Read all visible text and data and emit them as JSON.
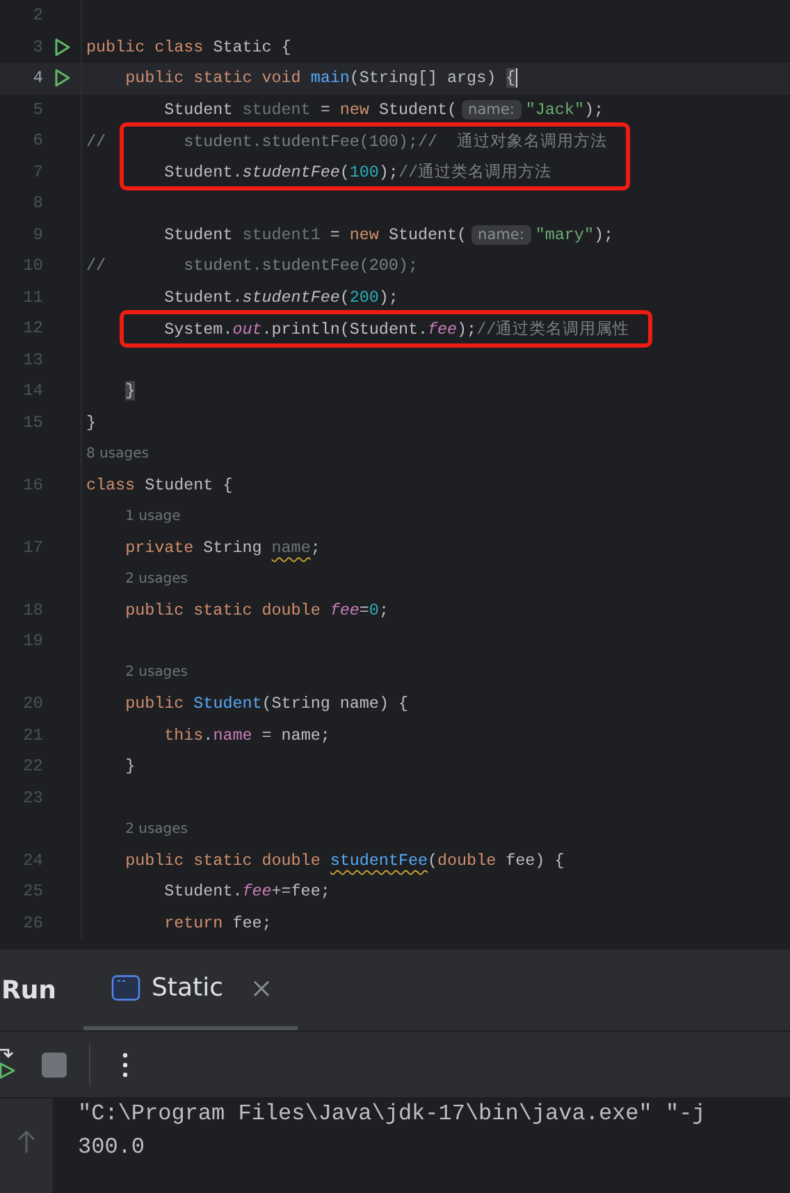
{
  "editor": {
    "lines": [
      {
        "kind": "code",
        "number": "2",
        "run_icon": false,
        "current": false,
        "boxed": false
      },
      {
        "kind": "code",
        "number": "3",
        "run_icon": true,
        "current": false,
        "boxed": false,
        "tokens": [
          {
            "kind": "kw",
            "text": "public class "
          },
          {
            "kind": "plain",
            "text": "Static {"
          }
        ]
      },
      {
        "kind": "code",
        "number": "4",
        "run_icon": true,
        "current": true,
        "boxed": false,
        "tokens": [
          {
            "kind": "kw",
            "text": "    public static void "
          },
          {
            "kind": "decl",
            "text": "main"
          },
          {
            "kind": "plain",
            "text": "(String[] args) "
          },
          {
            "kind": "match",
            "text": "{"
          }
        ]
      },
      {
        "kind": "code",
        "number": "5",
        "run_icon": false,
        "current": false,
        "boxed": false,
        "tokens": [
          {
            "kind": "plain",
            "text": "        Student "
          },
          {
            "kind": "unused",
            "text": "student"
          },
          {
            "kind": "plain",
            "text": " = "
          },
          {
            "kind": "kw",
            "text": "new "
          },
          {
            "kind": "plain",
            "text": "Student("
          },
          {
            "kind": "hint",
            "text": "name:"
          },
          {
            "kind": "str",
            "text": "\"Jack\""
          },
          {
            "kind": "plain",
            "text": ");"
          }
        ]
      },
      {
        "kind": "code",
        "number": "6",
        "run_icon": false,
        "current": false,
        "boxed": true,
        "tokens": [
          {
            "kind": "cmt",
            "text": "//        student.studentFee(100);//  通过对象名调用方法"
          }
        ]
      },
      {
        "kind": "code",
        "number": "7",
        "run_icon": false,
        "current": false,
        "boxed": true,
        "tokens": [
          {
            "kind": "plain",
            "text": "        Student."
          },
          {
            "kind": "scall",
            "text": "studentFee"
          },
          {
            "kind": "plain",
            "text": "("
          },
          {
            "kind": "num",
            "text": "100"
          },
          {
            "kind": "plain",
            "text": ");"
          },
          {
            "kind": "cmt",
            "text": "//通过类名调用方法"
          }
        ]
      },
      {
        "kind": "code",
        "number": "8",
        "run_icon": false,
        "current": false,
        "boxed": false
      },
      {
        "kind": "code",
        "number": "9",
        "run_icon": false,
        "current": false,
        "boxed": false,
        "tokens": [
          {
            "kind": "plain",
            "text": "        Student "
          },
          {
            "kind": "unused",
            "text": "student1"
          },
          {
            "kind": "plain",
            "text": " = "
          },
          {
            "kind": "kw",
            "text": "new "
          },
          {
            "kind": "plain",
            "text": "Student("
          },
          {
            "kind": "hint",
            "text": "name:"
          },
          {
            "kind": "str",
            "text": "\"mary\""
          },
          {
            "kind": "plain",
            "text": ");"
          }
        ]
      },
      {
        "kind": "code",
        "number": "10",
        "run_icon": false,
        "current": false,
        "boxed": false,
        "tokens": [
          {
            "kind": "cmt",
            "text": "//        student.studentFee(200);"
          }
        ]
      },
      {
        "kind": "code",
        "number": "11",
        "run_icon": false,
        "current": false,
        "boxed": false,
        "tokens": [
          {
            "kind": "plain",
            "text": "        Student."
          },
          {
            "kind": "scall",
            "text": "studentFee"
          },
          {
            "kind": "plain",
            "text": "("
          },
          {
            "kind": "num",
            "text": "200"
          },
          {
            "kind": "plain",
            "text": ");"
          }
        ]
      },
      {
        "kind": "code",
        "number": "12",
        "run_icon": false,
        "current": false,
        "boxed": true,
        "tokens": [
          {
            "kind": "plain",
            "text": "        System."
          },
          {
            "kind": "sfield",
            "text": "out"
          },
          {
            "kind": "plain",
            "text": ".println(Student."
          },
          {
            "kind": "sfield",
            "text": "fee"
          },
          {
            "kind": "plain",
            "text": ");"
          },
          {
            "kind": "cmt",
            "text": "//通过类名调用属性"
          }
        ]
      },
      {
        "kind": "code",
        "number": "13",
        "run_icon": false,
        "current": false,
        "boxed": false
      },
      {
        "kind": "code",
        "number": "14",
        "run_icon": false,
        "current": false,
        "boxed": false,
        "tokens": [
          {
            "kind": "match",
            "text": "    }"
          }
        ]
      },
      {
        "kind": "code",
        "number": "15",
        "run_icon": false,
        "current": false,
        "boxed": false,
        "tokens": [
          {
            "kind": "plain",
            "text": "}"
          }
        ]
      },
      {
        "kind": "usages",
        "text": "8 usages"
      },
      {
        "kind": "code",
        "number": "16",
        "run_icon": false,
        "current": false,
        "boxed": false,
        "tokens": [
          {
            "kind": "kw",
            "text": "class "
          },
          {
            "kind": "plain",
            "text": "Student {"
          }
        ]
      },
      {
        "kind": "usages",
        "text": "    1 usage"
      },
      {
        "kind": "code",
        "number": "17",
        "run_icon": false,
        "current": false,
        "boxed": false,
        "tokens": [
          {
            "kind": "kw",
            "text": "    private "
          },
          {
            "kind": "plain",
            "text": "String "
          },
          {
            "kind": "warnunused",
            "text": "name"
          },
          {
            "kind": "plain",
            "text": ";"
          }
        ]
      },
      {
        "kind": "usages",
        "text": "    2 usages"
      },
      {
        "kind": "code",
        "number": "18",
        "run_icon": false,
        "current": false,
        "boxed": false,
        "tokens": [
          {
            "kind": "kw",
            "text": "    public static double "
          },
          {
            "kind": "sfield",
            "text": "fee"
          },
          {
            "kind": "plain",
            "text": "="
          },
          {
            "kind": "num",
            "text": "0"
          },
          {
            "kind": "plain",
            "text": ";"
          }
        ]
      },
      {
        "kind": "code",
        "number": "19",
        "run_icon": false,
        "current": false,
        "boxed": false
      },
      {
        "kind": "usages",
        "text": "    2 usages"
      },
      {
        "kind": "code",
        "number": "20",
        "run_icon": false,
        "current": false,
        "boxed": false,
        "tokens": [
          {
            "kind": "kw",
            "text": "    public "
          },
          {
            "kind": "decl",
            "text": "Student"
          },
          {
            "kind": "plain",
            "text": "(String name) {"
          }
        ]
      },
      {
        "kind": "code",
        "number": "21",
        "run_icon": false,
        "current": false,
        "boxed": false,
        "tokens": [
          {
            "kind": "kw",
            "text": "        this"
          },
          {
            "kind": "plain",
            "text": "."
          },
          {
            "kind": "field",
            "text": "name"
          },
          {
            "kind": "plain",
            "text": " = name;"
          }
        ]
      },
      {
        "kind": "code",
        "number": "22",
        "run_icon": false,
        "current": false,
        "boxed": false,
        "tokens": [
          {
            "kind": "plain",
            "text": "    }"
          }
        ]
      },
      {
        "kind": "code",
        "number": "23",
        "run_icon": false,
        "current": false,
        "boxed": false
      },
      {
        "kind": "usages",
        "text": "    2 usages"
      },
      {
        "kind": "code",
        "number": "24",
        "run_icon": false,
        "current": false,
        "boxed": false,
        "tokens": [
          {
            "kind": "kw",
            "text": "    public static double "
          },
          {
            "kind": "warndecl",
            "text": "studentFee"
          },
          {
            "kind": "plain",
            "text": "("
          },
          {
            "kind": "kw",
            "text": "double "
          },
          {
            "kind": "plain",
            "text": "fee) {"
          }
        ]
      },
      {
        "kind": "code",
        "number": "25",
        "run_icon": false,
        "current": false,
        "boxed": false,
        "tokens": [
          {
            "kind": "plain",
            "text": "        Student."
          },
          {
            "kind": "sfield",
            "text": "fee"
          },
          {
            "kind": "plain",
            "text": "+=fee;"
          }
        ]
      },
      {
        "kind": "code",
        "number": "26",
        "run_icon": false,
        "current": false,
        "boxed": false,
        "tokens": [
          {
            "kind": "kw",
            "text": "        return "
          },
          {
            "kind": "plain",
            "text": "fee;"
          }
        ]
      }
    ]
  },
  "run_panel": {
    "title": "Run",
    "tabs": [
      {
        "label": "Static",
        "selected": true
      }
    ],
    "toolbar": [
      {
        "kind": "rerun"
      },
      {
        "kind": "stop",
        "disabled": true
      },
      {
        "kind": "separator"
      },
      {
        "kind": "more"
      }
    ],
    "console": [
      "\"C:\\Program Files\\Java\\jdk-17\\bin\\java.exe\" \"-j",
      "300.0"
    ]
  }
}
